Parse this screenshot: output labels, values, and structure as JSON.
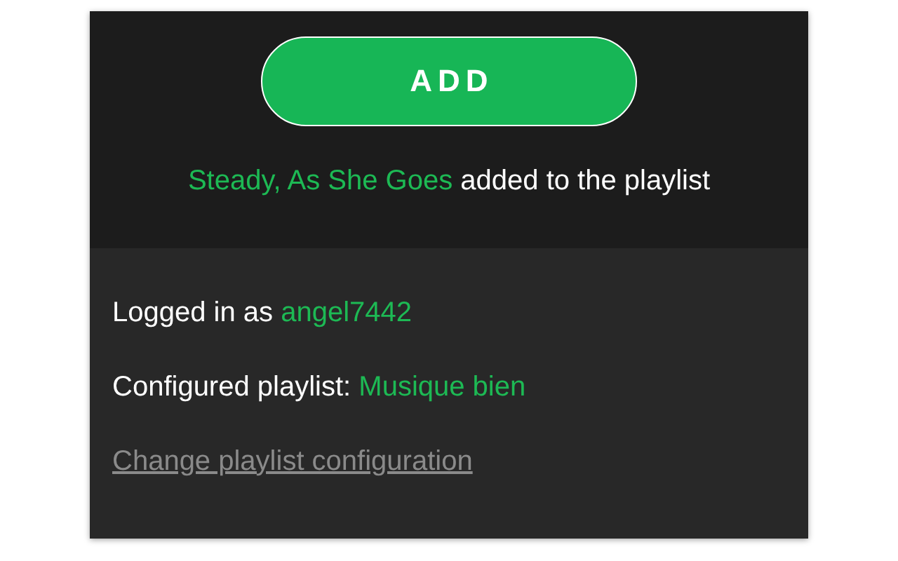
{
  "add_button": {
    "label": "ADD"
  },
  "status_message": {
    "track": "Steady, As She Goes",
    "text": "added to the playlist"
  },
  "account": {
    "label": "Logged in as",
    "value": "angel7442"
  },
  "playlist": {
    "label": "Configured playlist:",
    "value": "Musique bien"
  },
  "change_link": {
    "label": "Change playlist configuration"
  }
}
